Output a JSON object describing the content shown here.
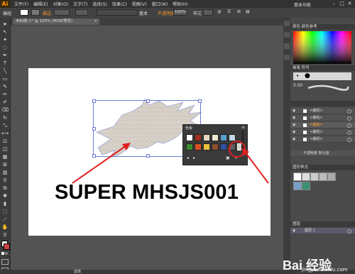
{
  "app": {
    "logo": "Ai",
    "workspace": "基本功能",
    "window_controls": [
      "–",
      "□",
      "✕"
    ]
  },
  "menu": [
    "文件(F)",
    "编辑(E)",
    "对象(O)",
    "文字(T)",
    "选择(S)",
    "效果(C)",
    "视图(V)",
    "窗口(W)",
    "帮助(H)"
  ],
  "control_bar": {
    "object_type": "编组",
    "stroke_label": "描边",
    "stroke_value": "",
    "brush_label": "基本",
    "opacity_label": "不透明度",
    "opacity_value": "100%",
    "style_label": "样式"
  },
  "document_tab": {
    "title": "未标题-1* @ 100% (RGB/预览)",
    "close": "×"
  },
  "artboard": {
    "main_text": "SUPER MHSJS001"
  },
  "swatch_popup": {
    "title": "色板"
  },
  "right_panels": {
    "color_header": "颜色  颜色参考",
    "brush_header": "画笔  符号",
    "stroke_value": "0.00",
    "appearance_header": "",
    "layers": [
      {
        "label": "<编组>"
      },
      {
        "label": "<编组>"
      },
      {
        "label": "<编组>"
      },
      {
        "label": "<编组>"
      },
      {
        "label": "<编组>"
      }
    ],
    "layer_item": "不透明度  默认值",
    "graphic_styles_header": "图形样式",
    "layers_header": "图层",
    "layer_name": "图层 1"
  },
  "status_bar": {
    "tool": "选择"
  },
  "watermark": {
    "brand": "Bai 经验",
    "url": "jingyan.baidu.com"
  },
  "colors": {
    "accent_orange": "#ff9a00",
    "selection_blue": "#6a7bd6",
    "arrow_red": "#e02020"
  }
}
